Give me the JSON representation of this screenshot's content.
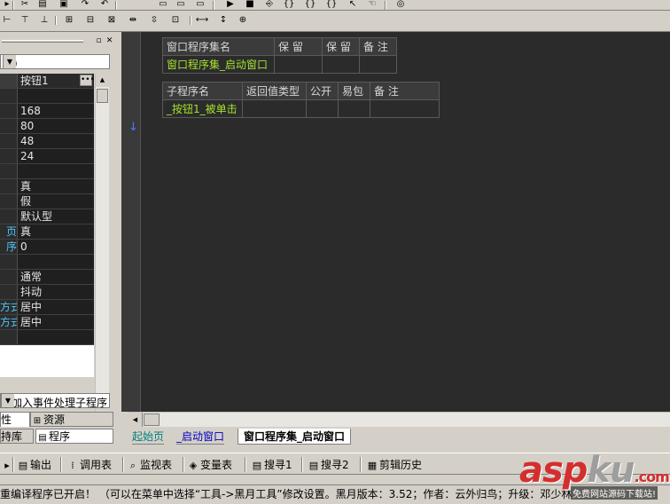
{
  "toolbar": {
    "buttons": [
      "cut-icon",
      "copy-icon",
      "paste-icon",
      "undo-icon",
      "grid1-icon",
      "grid2-icon",
      "grid3-icon",
      "grid4-icon",
      "align1-icon",
      "align2-icon",
      "align3-icon",
      "align4-icon",
      "align5-icon",
      "align6-icon",
      "size1-icon",
      "size2-icon",
      "size3-icon",
      "window1-icon",
      "window2-icon",
      "window3-icon",
      "run-icon",
      "stop-icon",
      "step1-icon",
      "step2-icon",
      "step3-icon",
      "step4-icon",
      "hand-icon",
      "binoculars-icon"
    ]
  },
  "left_panel": {
    "combo_value": "钮）",
    "props": [
      {
        "k": "",
        "v": "按钮1",
        "head": true
      },
      {
        "k": "",
        "v": ""
      },
      {
        "k": "",
        "v": "168"
      },
      {
        "k": "",
        "v": "80"
      },
      {
        "k": "",
        "v": "48"
      },
      {
        "k": "",
        "v": "24"
      },
      {
        "k": "",
        "v": ""
      },
      {
        "k": "",
        "v": "真"
      },
      {
        "k": "",
        "v": "假"
      },
      {
        "k": "",
        "v": "默认型"
      },
      {
        "k": "页",
        "v": "真"
      },
      {
        "k": "序",
        "v": "0"
      },
      {
        "k": "",
        "v": ""
      },
      {
        "k": "",
        "v": "通常"
      },
      {
        "k": "",
        "v": "抖动"
      },
      {
        "k": "方式",
        "v": "居中"
      },
      {
        "k": "方式",
        "v": "居中"
      },
      {
        "k": "",
        "v": ""
      }
    ],
    "event_combo": "添加入事件处理子程序",
    "tabs": {
      "prop": "性",
      "resource": "资源",
      "lib": "持库",
      "program": "程序"
    }
  },
  "editor": {
    "set_header": [
      "窗口程序集名",
      "保 留",
      "保 留",
      "备 注"
    ],
    "set_row": [
      "窗口程序集_启动窗口",
      "",
      "",
      ""
    ],
    "sub_header": [
      "子程序名",
      "返回值类型",
      "公开",
      "易包",
      "备 注"
    ],
    "sub_row": [
      "_按钮1_被单击",
      "",
      "",
      "",
      ""
    ]
  },
  "doc_tabs": [
    "起始页",
    "_启动窗口",
    "窗口程序集_启动窗口"
  ],
  "bottom_tabs": [
    "",
    "输出",
    "调用表",
    "监视表",
    "变量表",
    "搜寻1",
    "搜寻2",
    "剪辑历史"
  ],
  "status": "重编译程序已开启！ （可以在菜单中选择“工具->黑月工具”修改设置。黑月版本：3.52；作者：云外归鸟；升级：邓少林",
  "watermark": {
    "logo_a": "asp",
    "logo_b": "ku",
    "logo_c": ".com",
    "sub": "免费网站源码下载站!"
  }
}
